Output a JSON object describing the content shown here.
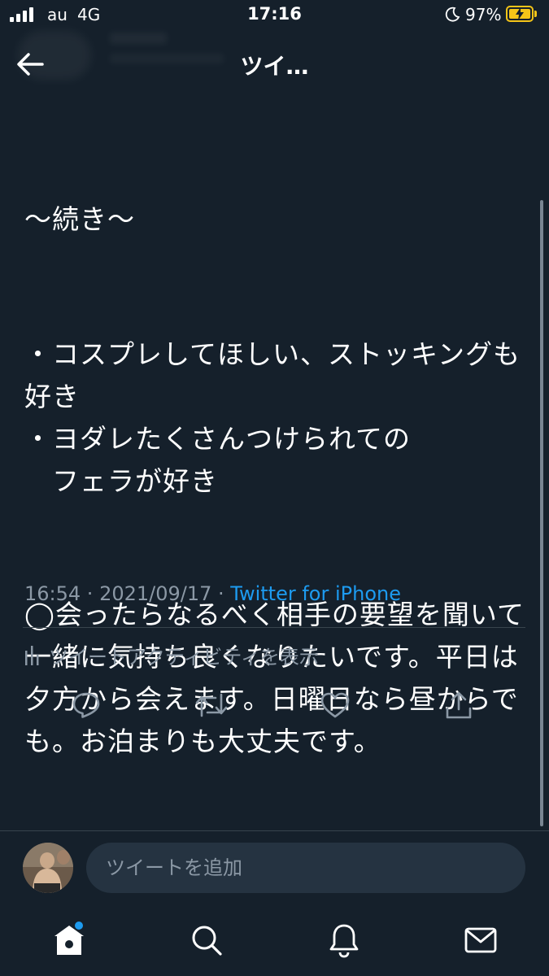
{
  "status_bar": {
    "carrier": "au",
    "network": "4G",
    "time": "17:16",
    "battery_percent": "97%",
    "icons": [
      "signal-icon",
      "moon-icon",
      "battery-charging-icon"
    ],
    "battery_color": "#f5c518"
  },
  "header": {
    "title": "ツイ…",
    "back_icon": "back-arrow-icon"
  },
  "tweet": {
    "paragraphs": [
      "〜続き〜",
      "・コスプレしてほしい、ストッキングも好き\n・ヨダレたくさんつけられての\n　フェラが好き",
      "◯会ったらなるべく相手の要望を聞いて一緒に気持ち良くなりたいです。平日は夕方から会えます。日曜日なら昼からでも。お泊まりも大丈夫です。"
    ],
    "time": "16:54",
    "date": "2021/09/17",
    "separator": " · ",
    "source": "Twitter for iPhone"
  },
  "activity": {
    "label": "ツイートアクティビティを表示",
    "icon": "analytics-icon"
  },
  "actions": [
    {
      "name": "reply",
      "icon": "reply-icon"
    },
    {
      "name": "retweet",
      "icon": "retweet-icon"
    },
    {
      "name": "like",
      "icon": "heart-icon"
    },
    {
      "name": "share",
      "icon": "share-icon"
    }
  ],
  "reply_bar": {
    "placeholder": "ツイートを追加"
  },
  "tab_bar": [
    {
      "name": "home",
      "icon": "home-icon",
      "has_notification": true
    },
    {
      "name": "search",
      "icon": "search-icon"
    },
    {
      "name": "notifications",
      "icon": "bell-icon"
    },
    {
      "name": "messages",
      "icon": "mail-icon"
    }
  ],
  "colors": {
    "background": "#15202b",
    "text": "#ffffff",
    "secondary_text": "#8b98a5",
    "accent": "#1d9bf0",
    "divider": "#38444d"
  }
}
